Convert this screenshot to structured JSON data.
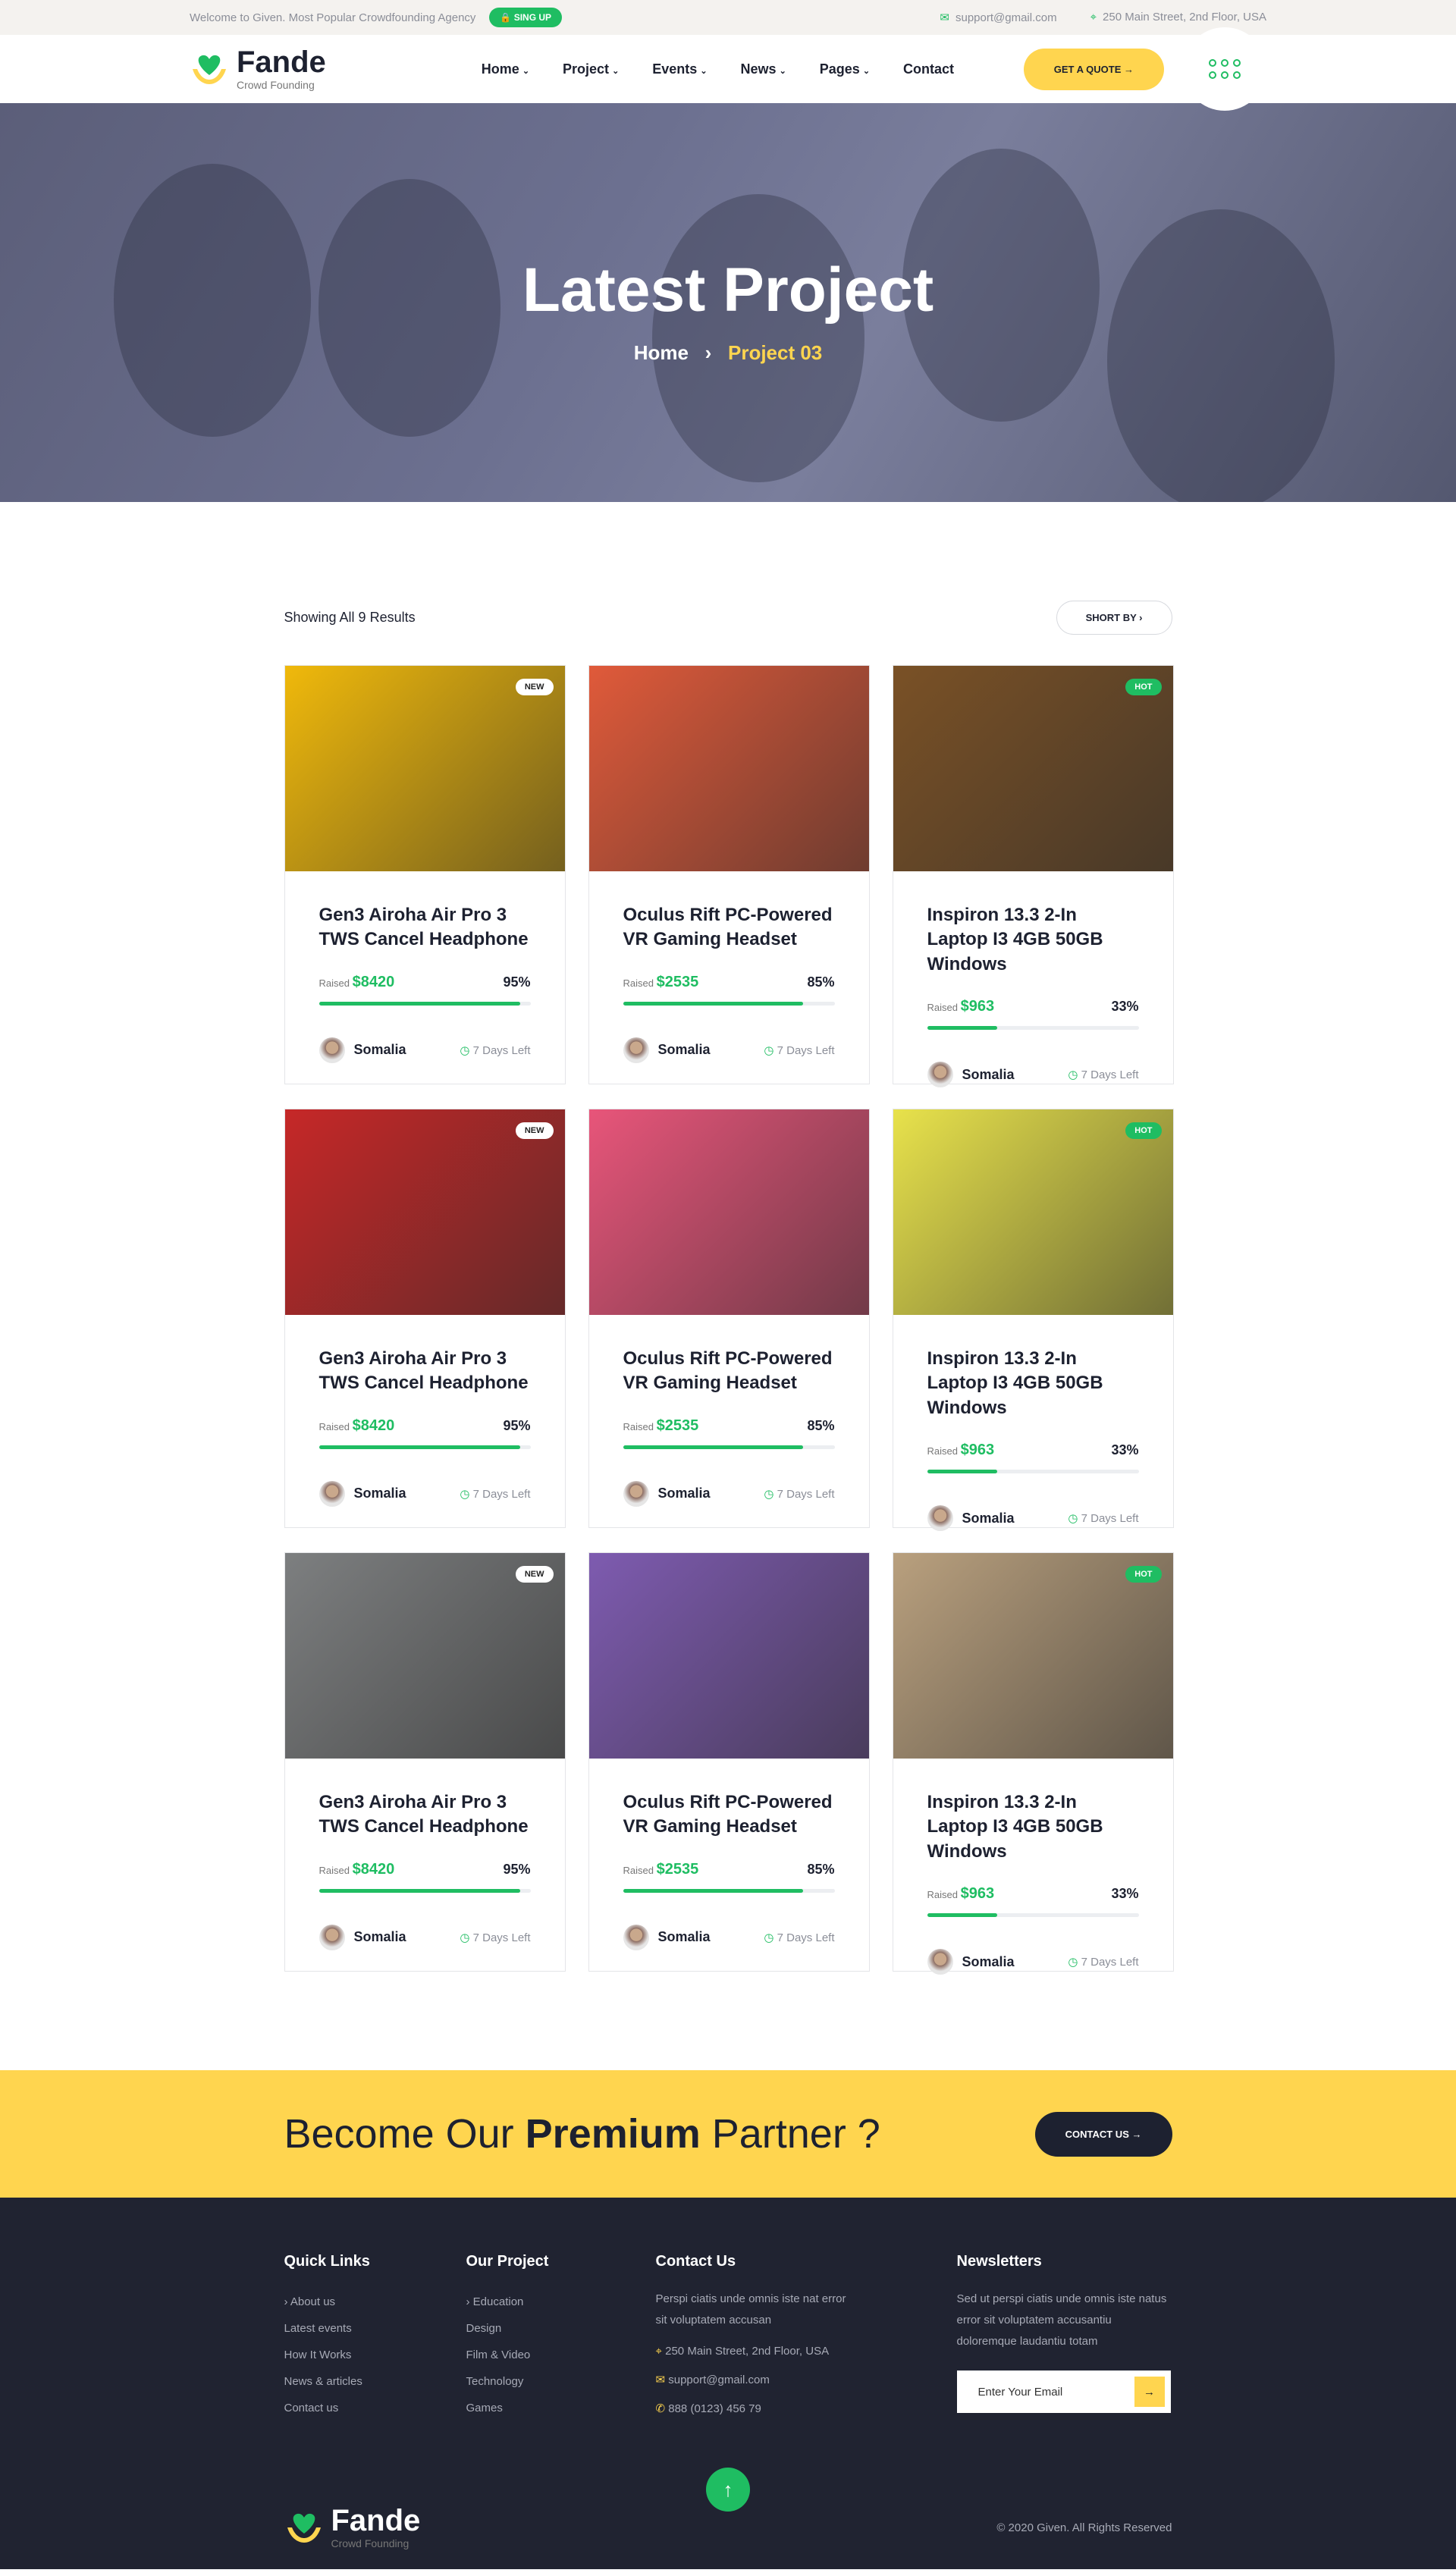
{
  "topbar": {
    "welcome": "Welcome to Given. Most Popular Crowdfounding Agency",
    "signup": "SING UP",
    "email": "support@gmail.com",
    "address": "250 Main Street, 2nd Floor, USA"
  },
  "brand": {
    "name": "Fande",
    "tagline": "Crowd Founding",
    "green": "#1fbd62",
    "yellow": "#ffd54f",
    "dark": "#1d2130"
  },
  "nav": {
    "items": [
      "Home",
      "Project",
      "Events",
      "News",
      "Pages",
      "Contact"
    ],
    "quote": "GET A QUOTE"
  },
  "hero": {
    "title": "Latest Project",
    "crumb_home": "Home",
    "crumb_current": "Project 03"
  },
  "listing": {
    "results": "Showing All 9 Results",
    "sort": "SHORT BY"
  },
  "cards": [
    {
      "badge": "NEW",
      "title": "Gen3 Airoha Air Pro 3 TWS Cancel Headphone",
      "raised_label": "Raised",
      "raised": "$8420",
      "percent": "95%",
      "progress": 95,
      "author": "Somalia",
      "days": "7 Days Left"
    },
    {
      "badge": "",
      "title": "Oculus Rift PC-Powered VR Gaming Headset",
      "raised_label": "Raised",
      "raised": "$2535",
      "percent": "85%",
      "progress": 85,
      "author": "Somalia",
      "days": "7 Days Left"
    },
    {
      "badge": "HOT",
      "title": "Inspiron 13.3 2-In Laptop I3 4GB 50GB Windows",
      "raised_label": "Raised",
      "raised": "$963",
      "percent": "33%",
      "progress": 33,
      "author": "Somalia",
      "days": "7 Days Left"
    },
    {
      "badge": "NEW",
      "title": "Gen3 Airoha Air Pro 3 TWS Cancel Headphone",
      "raised_label": "Raised",
      "raised": "$8420",
      "percent": "95%",
      "progress": 95,
      "author": "Somalia",
      "days": "7 Days Left"
    },
    {
      "badge": "",
      "title": "Oculus Rift PC-Powered VR Gaming Headset",
      "raised_label": "Raised",
      "raised": "$2535",
      "percent": "85%",
      "progress": 85,
      "author": "Somalia",
      "days": "7 Days Left"
    },
    {
      "badge": "HOT",
      "title": "Inspiron 13.3 2-In Laptop I3 4GB 50GB Windows",
      "raised_label": "Raised",
      "raised": "$963",
      "percent": "33%",
      "progress": 33,
      "author": "Somalia",
      "days": "7 Days Left"
    },
    {
      "badge": "NEW",
      "title": "Gen3 Airoha Air Pro 3 TWS Cancel Headphone",
      "raised_label": "Raised",
      "raised": "$8420",
      "percent": "95%",
      "progress": 95,
      "author": "Somalia",
      "days": "7 Days Left"
    },
    {
      "badge": "",
      "title": "Oculus Rift PC-Powered VR Gaming Headset",
      "raised_label": "Raised",
      "raised": "$2535",
      "percent": "85%",
      "progress": 85,
      "author": "Somalia",
      "days": "7 Days Left"
    },
    {
      "badge": "HOT",
      "title": "Inspiron 13.3 2-In Laptop I3 4GB 50GB Windows",
      "raised_label": "Raised",
      "raised": "$963",
      "percent": "33%",
      "progress": 33,
      "author": "Somalia",
      "days": "7 Days Left"
    }
  ],
  "card_colors": [
    "#f0b90b",
    "#e05a3a",
    "#7a5126",
    "#c62828",
    "#e8557a",
    "#e8e24b",
    "#7d7f80",
    "#7e5bb0",
    "#b9a07e"
  ],
  "cta": {
    "pre": "Become Our ",
    "bold": "Premium",
    "post": " Partner ?",
    "button": "CONTACT US"
  },
  "footer": {
    "quick": {
      "title": "Quick Links",
      "items": [
        "About us",
        "Latest events",
        "How It Works",
        "News & articles",
        "Contact us"
      ]
    },
    "project": {
      "title": "Our Project",
      "items": [
        "Education",
        "Design",
        "Film & Video",
        "Technology",
        "Games"
      ]
    },
    "contact": {
      "title": "Contact Us",
      "text": "Perspi ciatis unde omnis iste nat error sit voluptatem accusan",
      "address": "250 Main Street, 2nd Floor, USA",
      "email": "support@gmail.com",
      "phone": "888 (0123) 456 79"
    },
    "newsletter": {
      "title": "Newsletters",
      "text": "Sed ut perspi ciatis unde omnis iste natus error sit voluptatem accusantiu doloremque laudantiu totam",
      "placeholder": "Enter Your Email"
    },
    "copyright": "© 2020 Given. All Rights Reserved"
  }
}
